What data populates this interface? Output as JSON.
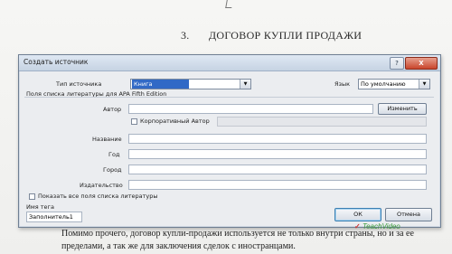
{
  "document": {
    "heading_number": "3.",
    "heading_text": "ДОГОВОР КУПЛИ ПРОДАЖИ",
    "body_line1": "Помимо прочего, договор купли-продажи используется не только внутри страны, но и за ее",
    "body_line2": "пределами, а так же для заключения сделок с иностранцами.",
    "logo_text": "TeachVideo"
  },
  "dialog": {
    "title": "Создать источник",
    "help_label": "?",
    "close_label": "X",
    "source_type_label": "Тип источника",
    "source_type_value": "Книга",
    "language_label": "Язык",
    "language_value": "По умолчанию",
    "fields_group_label": "Поля списка литературы для APA Fifth Edition",
    "author_label": "Автор",
    "edit_button": "Изменить",
    "corporate_author_label": "Корпоративный Автор",
    "title_label": "Название",
    "year_label": "Год",
    "city_label": "Город",
    "publisher_label": "Издательство",
    "show_all_label": "Показать все поля списка литературы",
    "tag_name_label": "Имя тега",
    "tag_name_value": "Заполнитель1",
    "ok_button": "ОК",
    "cancel_button": "Отмена"
  },
  "icons": {
    "dropdown": "chevron-down-icon",
    "check": "check-icon"
  },
  "colors": {
    "selection": "#3169c6",
    "close_button": "#c9452c",
    "dialog_frame": "#d3dbe5"
  }
}
